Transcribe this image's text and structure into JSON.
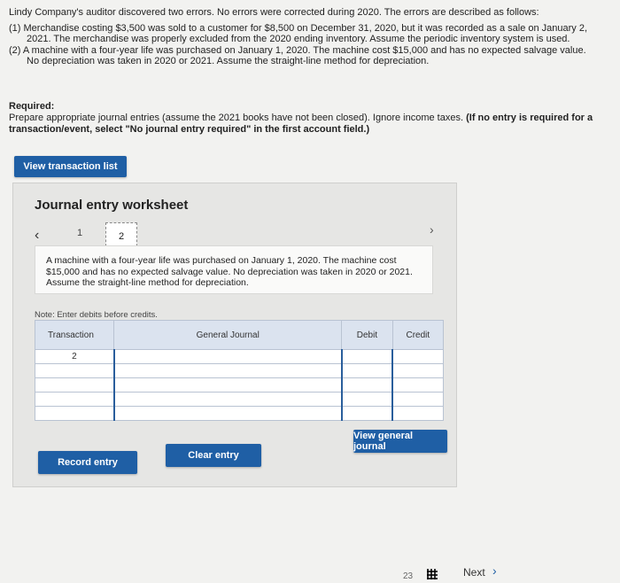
{
  "problem": {
    "headline": "Lindy Company's auditor discovered two errors. No errors were corrected during 2020. The errors are described as follows:",
    "item1_line1": "(1) Merchandise costing $3,500 was sold to a customer for $8,500 on December 31, 2020, but it was recorded as a sale on January 2,",
    "item1_line2": "2021. The merchandise was properly excluded from the 2020 ending inventory. Assume the periodic inventory system is used.",
    "item2_line1": "(2) A machine with a four-year life was purchased on January 1, 2020. The machine cost $15,000 and has no expected salvage value.",
    "item2_line2": "No depreciation was taken in 2020 or 2021. Assume the straight-line method for depreciation."
  },
  "required": {
    "label": "Required:",
    "text": "Prepare appropriate journal entries (assume the 2021 books have not been closed). Ignore income taxes.",
    "bold_text": "(If no entry is required for a transaction/event, select \"No journal entry required\" in the first account field.)"
  },
  "buttons": {
    "view_transaction_list": "View transaction list",
    "record_entry": "Record entry",
    "clear_entry": "Clear entry",
    "view_general_journal": "View general journal"
  },
  "worksheet": {
    "title": "Journal entry worksheet",
    "page1": "1",
    "page2": "2",
    "description": "A machine with a four-year life was purchased on January 1, 2020. The machine cost $15,000 and has no expected salvage value. No depreciation was taken in 2020 or 2021. Assume the straight-line method for depreciation.",
    "note": "Note: Enter debits before credits."
  },
  "table": {
    "headers": {
      "transaction": "Transaction",
      "general_journal": "General Journal",
      "debit": "Debit",
      "credit": "Credit"
    },
    "transaction_number": "2"
  },
  "footer": {
    "page_num": "23",
    "next": "Next"
  },
  "icons": {
    "prev": "chevron-left-icon",
    "next": "chevron-right-icon",
    "grid": "grid-icon"
  },
  "colors": {
    "accent": "#1f5fa5",
    "header_bg": "#dbe3ef"
  }
}
